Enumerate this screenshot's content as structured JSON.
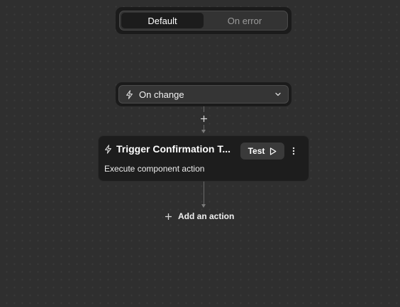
{
  "mode_tabs": {
    "default_label": "Default",
    "error_label": "On error",
    "active": "Default"
  },
  "trigger": {
    "label": "On change",
    "icon": "lightning-icon"
  },
  "action_card": {
    "icon": "lightning-icon",
    "title": "Trigger Confirmation T...",
    "description": "Execute component action",
    "test_label": "Test"
  },
  "add_action": {
    "label": "Add an action"
  },
  "colors": {
    "canvas": "#2f2f2f",
    "card": "#1d1d1d",
    "accent_text": "#ffffff",
    "muted_text": "#9a9a9a"
  }
}
